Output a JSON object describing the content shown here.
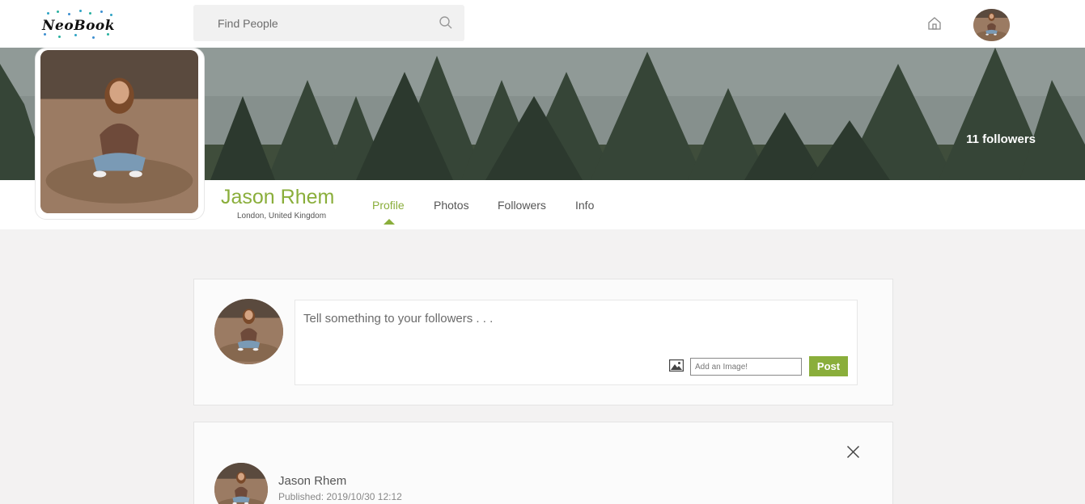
{
  "app": {
    "logo_text": "NeoBook"
  },
  "navbar": {
    "search_placeholder": "Find People",
    "search_icon": "search-icon",
    "home_icon": "home-icon"
  },
  "cover": {
    "followers_label": "11 followers"
  },
  "profile": {
    "name": "Jason Rhem",
    "location": "London, United Kingdom",
    "tabs": [
      {
        "label": "Profile",
        "active": true
      },
      {
        "label": "Photos",
        "active": false
      },
      {
        "label": "Followers",
        "active": false
      },
      {
        "label": "Info",
        "active": false
      }
    ]
  },
  "composer": {
    "placeholder": "Tell something to your followers . . .",
    "image_icon": "image-icon",
    "image_input_placeholder": "Add an Image!",
    "post_label": "Post"
  },
  "post": {
    "author": "Jason Rhem",
    "published": "Published: 2019/10/30 12:12",
    "close_icon": "close-icon"
  },
  "colors": {
    "accent": "#8aae3b",
    "page_bg": "#f3f2f2",
    "card_bg": "#fbfbfb"
  }
}
